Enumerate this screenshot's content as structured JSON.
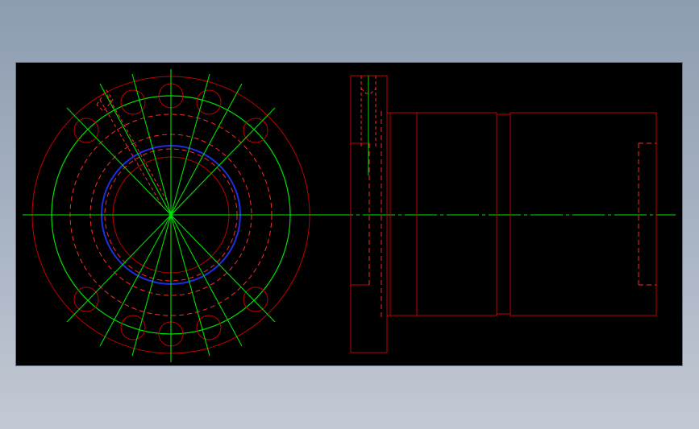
{
  "colors": {
    "canvas_background": "#000000",
    "page_background_top": "#8d9cb0",
    "page_background_bottom": "#c3c9d4",
    "outline_red": "#c00000",
    "hidden_red": "#ff2a2a",
    "centerline_green": "#00e000",
    "bore_blue": "#1f2fe0"
  },
  "icons": {
    "front_view": "flange-front-view",
    "side_view": "flange-side-section-view"
  }
}
